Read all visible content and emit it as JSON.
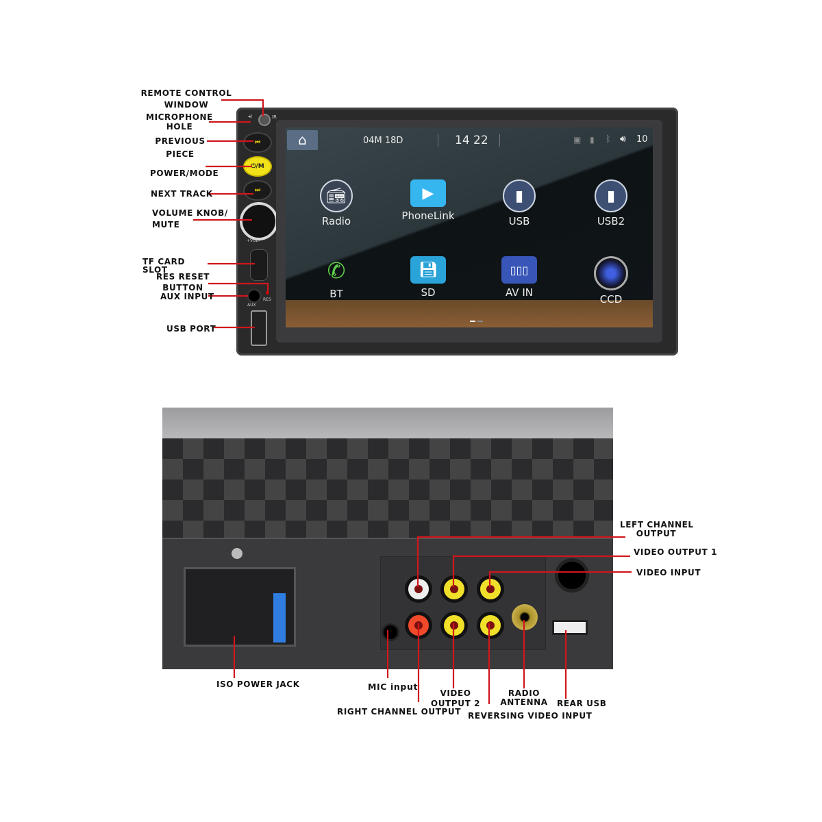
{
  "front_labels": {
    "remote_control": [
      "REMOTE CONTROL",
      "WINDOW"
    ],
    "microphone": [
      "MICROPHONE",
      "HOLE"
    ],
    "previous": [
      "PREVIOUS",
      "PIECE"
    ],
    "power_mode": "POWER/MODE",
    "next_track": "NEXT TRACK",
    "volume": [
      "VOLUME KNOB/",
      "MUTE"
    ],
    "tf_card": [
      "TF CARD",
      "SLOT"
    ],
    "res_reset": [
      "RES RESET",
      "BUTTON"
    ],
    "aux_input": "AUX INPUT",
    "usb_port": "USB PORT"
  },
  "panel_marks": {
    "ir": "IR",
    "power_button": "⏻/M",
    "prev_button": "⏮",
    "next_button": "⏭",
    "vol": "+VOL-",
    "aux": "AUX",
    "res": "RES"
  },
  "screen": {
    "date": "04M 18D",
    "time": "14 22",
    "volume": "10",
    "status_icons": [
      "sd-icon",
      "usb-icon",
      "bluetooth-icon",
      "speaker-icon"
    ],
    "apps": [
      {
        "label": "Radio",
        "icon": "radio-icon"
      },
      {
        "label": "PhoneLink",
        "icon": "phonelink-icon"
      },
      {
        "label": "USB",
        "icon": "usb-icon"
      },
      {
        "label": "USB2",
        "icon": "usb-icon"
      },
      {
        "label": "BT",
        "icon": "phone-icon"
      },
      {
        "label": "SD",
        "icon": "sd-card-icon"
      },
      {
        "label": "AV IN",
        "icon": "rca-icon"
      },
      {
        "label": "CCD",
        "icon": "camera-icon"
      }
    ],
    "page_indicator": {
      "pages": 2,
      "current": 1
    }
  },
  "rear_labels": {
    "left_channel": [
      "LEFT CHANNEL",
      "OUTPUT"
    ],
    "video_output_1": "VIDEO OUTPUT 1",
    "video_input": "VIDEO INPUT",
    "iso_power": "ISO POWER JACK",
    "mic_input": "MIC input",
    "right_channel": "RIGHT CHANNEL OUTPUT",
    "video_output_2": [
      "VIDEO",
      "OUTPUT 2"
    ],
    "reversing": "REVERSING VIDEO INPUT",
    "radio_antenna": [
      "RADIO",
      "ANTENNA"
    ],
    "rear_usb": "REAR USB"
  },
  "colors": {
    "leader_line": "#d0161b",
    "power_button": "#f2e21a",
    "phonelink": "#35b6ee",
    "sd": "#2aa3d8"
  }
}
